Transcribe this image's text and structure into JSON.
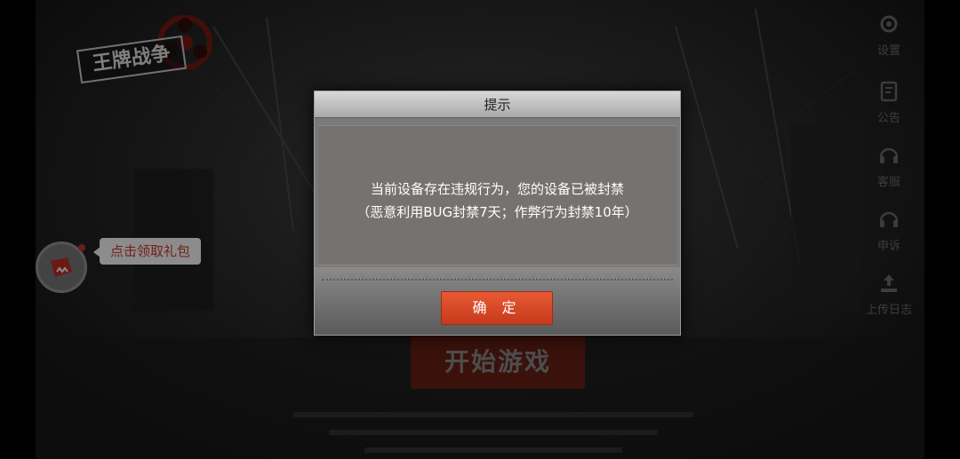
{
  "logo": {
    "text": "王牌战争"
  },
  "right_menu": {
    "items": [
      {
        "label": "设置",
        "icon": "gear-icon"
      },
      {
        "label": "公告",
        "icon": "notice-icon"
      },
      {
        "label": "客服",
        "icon": "headset-icon"
      },
      {
        "label": "申诉",
        "icon": "headset-icon"
      },
      {
        "label": "上传日志",
        "icon": "upload-icon"
      }
    ]
  },
  "gift": {
    "label": "点击领取礼包",
    "icon": "gift-icon"
  },
  "start_button": {
    "label": "开始游戏"
  },
  "modal": {
    "title": "提示",
    "message_line1": "当前设备存在违规行为，您的设备已被封禁",
    "message_line2": "（恶意利用BUG封禁7天；作弊行为封禁10年）",
    "confirm_label": "确 定"
  },
  "colors": {
    "accent": "#e0492a",
    "gift_text": "#d43b2b",
    "modal_bg": "#7a7a7a"
  }
}
